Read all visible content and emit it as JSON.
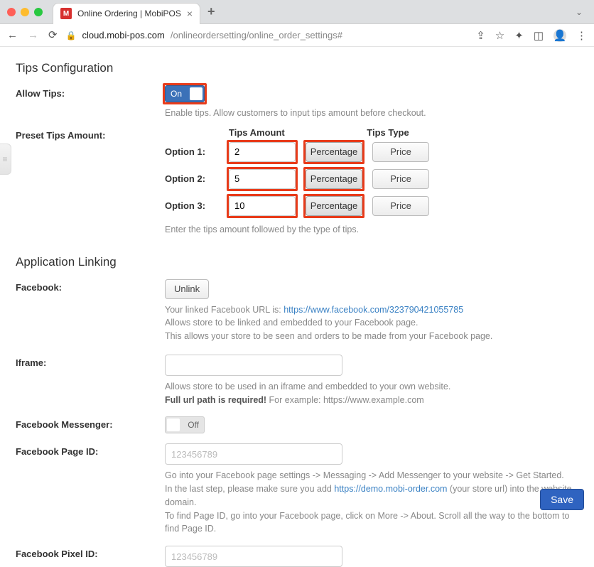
{
  "browser": {
    "tab_title": "Online Ordering | MobiPOS",
    "favicon_letter": "M",
    "url_host": "cloud.mobi-pos.com",
    "url_path": "/onlineordersetting/online_order_settings#"
  },
  "page": {
    "side_tab_icon": "≡",
    "section_tips": "Tips Configuration",
    "allow_tips": {
      "label": "Allow Tips:",
      "toggle_text": "On",
      "help": "Enable tips. Allow customers to input tips amount before checkout."
    },
    "preset_tips": {
      "label": "Preset Tips Amount:",
      "amount_header": "Tips Amount",
      "type_header": "Tips Type",
      "options": [
        {
          "name": "Option 1:",
          "amount": "2",
          "type_active": "Percentage",
          "type_other": "Price"
        },
        {
          "name": "Option 2:",
          "amount": "5",
          "type_active": "Percentage",
          "type_other": "Price"
        },
        {
          "name": "Option 3:",
          "amount": "10",
          "type_active": "Percentage",
          "type_other": "Price"
        }
      ],
      "help": "Enter the tips amount followed by the type of tips."
    },
    "section_linking": "Application Linking",
    "facebook": {
      "label": "Facebook:",
      "unlink_button": "Unlink",
      "help_pre": "Your linked Facebook URL is: ",
      "link": "https://www.facebook.com/323790421055785",
      "help_line2": "Allows store to be linked and embedded to your Facebook page.",
      "help_line3": "This allows your store to be seen and orders to be made from your Facebook page."
    },
    "iframe": {
      "label": "Iframe:",
      "help_line1": "Allows store to be used in an iframe and embedded to your own website.",
      "help_line2_bold": "Full url path is required!",
      "help_line2_rest": " For example: https://www.example.com"
    },
    "messenger": {
      "label": "Facebook Messenger:",
      "toggle_text": "Off"
    },
    "page_id": {
      "label": "Facebook Page ID:",
      "placeholder": "123456789",
      "help_line1": "Go into your Facebook page settings -> Messaging -> Add Messenger to your website -> Get Started.",
      "help_line2_pre": "In the last step, please make sure you add ",
      "help_line2_link": "https://demo.mobi-order.com",
      "help_line2_post": " (your store url) into the website domain.",
      "help_line3": "To find Page ID, go into your Facebook page, click on More -> About. Scroll all the way to the bottom to find Page ID."
    },
    "pixel_id": {
      "label": "Facebook Pixel ID:",
      "placeholder": "123456789"
    },
    "save_button": "Save"
  }
}
